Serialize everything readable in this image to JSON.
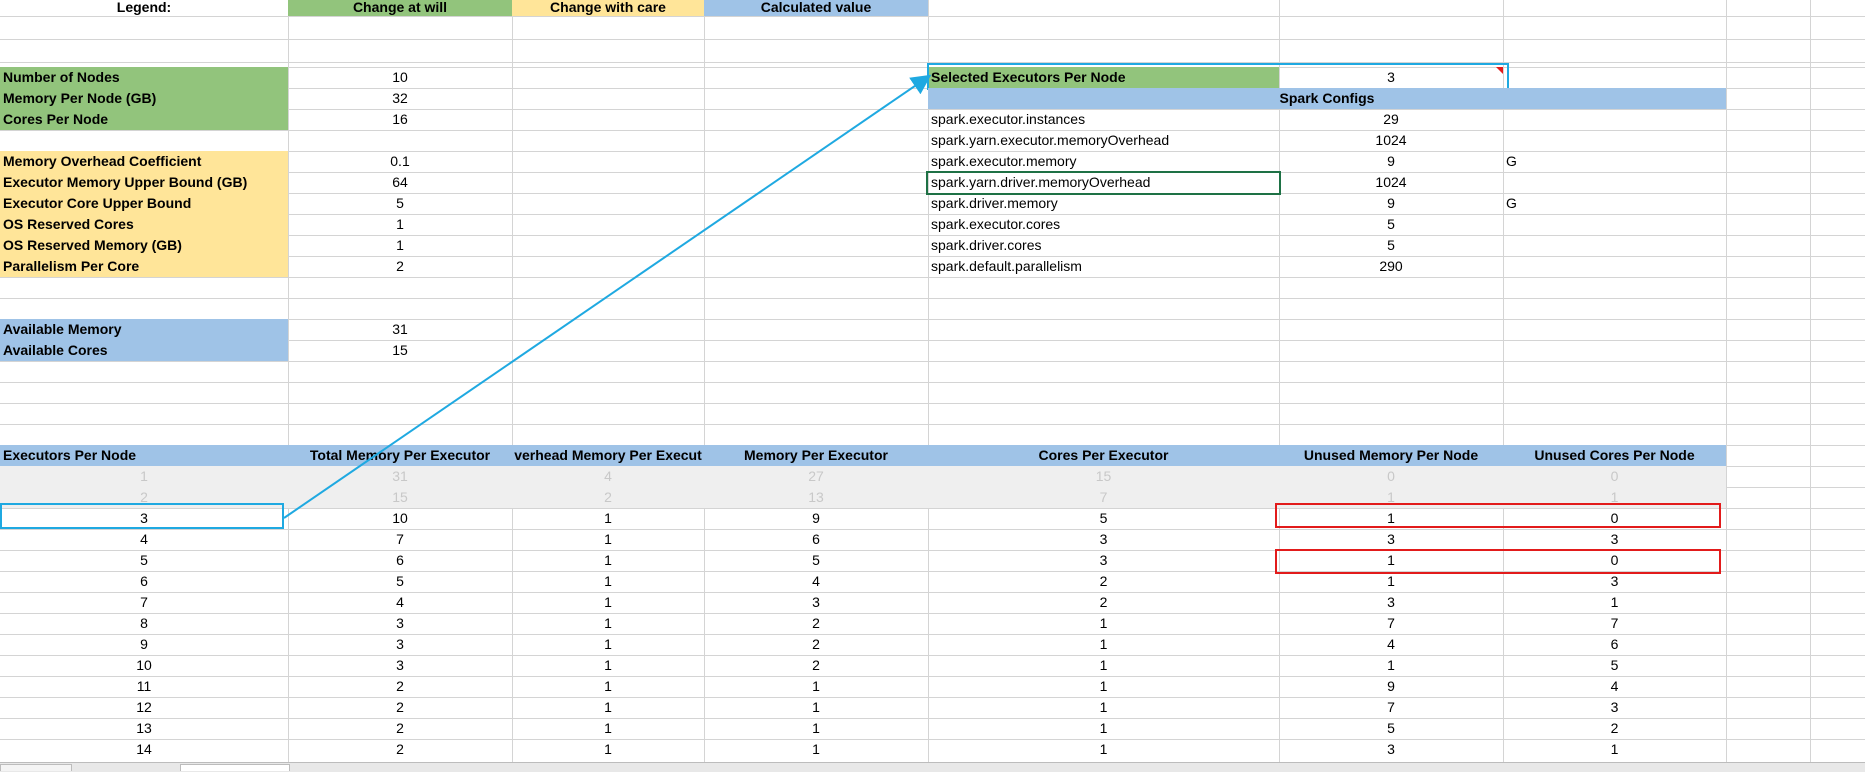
{
  "legend": {
    "label": "Legend:",
    "change_at_will": "Change at will",
    "change_with_care": "Change with care",
    "calculated_value": "Calculated value"
  },
  "inputs": [
    {
      "label": "Number of Nodes",
      "value": "10",
      "kind": "green"
    },
    {
      "label": "Memory Per Node (GB)",
      "value": "32",
      "kind": "green"
    },
    {
      "label": "Cores Per Node",
      "value": "16",
      "kind": "green"
    },
    {
      "label": "Memory Overhead Coefficient",
      "value": "0.1",
      "kind": "yellow"
    },
    {
      "label": "Executor Memory Upper Bound (GB)",
      "value": "64",
      "kind": "yellow"
    },
    {
      "label": "Executor Core Upper Bound",
      "value": "5",
      "kind": "yellow"
    },
    {
      "label": "OS Reserved Cores",
      "value": "1",
      "kind": "yellow"
    },
    {
      "label": "OS Reserved Memory (GB)",
      "value": "1",
      "kind": "yellow"
    },
    {
      "label": "Parallelism Per Core",
      "value": "2",
      "kind": "yellow"
    },
    {
      "label": "Available Memory",
      "value": "31",
      "kind": "blue"
    },
    {
      "label": "Available Cores",
      "value": "15",
      "kind": "blue"
    }
  ],
  "selected": {
    "label": "Selected Executors Per Node",
    "value": "3"
  },
  "spark_configs": {
    "title": "Spark Configs",
    "rows": [
      {
        "key": "spark.executor.instances",
        "value": "29",
        "unit": ""
      },
      {
        "key": "spark.yarn.executor.memoryOverhead",
        "value": "1024",
        "unit": ""
      },
      {
        "key": "spark.executor.memory",
        "value": "9",
        "unit": "G"
      },
      {
        "key": "spark.yarn.driver.memoryOverhead",
        "value": "1024",
        "unit": ""
      },
      {
        "key": "spark.driver.memory",
        "value": "9",
        "unit": "G"
      },
      {
        "key": "spark.executor.cores",
        "value": "5",
        "unit": ""
      },
      {
        "key": "spark.driver.cores",
        "value": "5",
        "unit": ""
      },
      {
        "key": "spark.default.parallelism",
        "value": "290",
        "unit": ""
      }
    ]
  },
  "table": {
    "headers": [
      "Executors Per Node",
      "Total Memory Per Executor",
      "verhead Memory Per Execut",
      "Memory Per Executor",
      "Cores Per Executor",
      "Unused Memory Per Node",
      "Unused Cores Per Node"
    ],
    "rows": [
      [
        "1",
        "31",
        "4",
        "27",
        "15",
        "0",
        "0"
      ],
      [
        "2",
        "15",
        "2",
        "13",
        "7",
        "1",
        "1"
      ],
      [
        "3",
        "10",
        "1",
        "9",
        "5",
        "1",
        "0"
      ],
      [
        "4",
        "7",
        "1",
        "6",
        "3",
        "3",
        "3"
      ],
      [
        "5",
        "6",
        "1",
        "5",
        "3",
        "1",
        "0"
      ],
      [
        "6",
        "5",
        "1",
        "4",
        "2",
        "1",
        "3"
      ],
      [
        "7",
        "4",
        "1",
        "3",
        "2",
        "3",
        "1"
      ],
      [
        "8",
        "3",
        "1",
        "2",
        "1",
        "7",
        "7"
      ],
      [
        "9",
        "3",
        "1",
        "2",
        "1",
        "4",
        "6"
      ],
      [
        "10",
        "3",
        "1",
        "2",
        "1",
        "1",
        "5"
      ],
      [
        "11",
        "2",
        "1",
        "1",
        "1",
        "9",
        "4"
      ],
      [
        "12",
        "2",
        "1",
        "1",
        "1",
        "7",
        "3"
      ],
      [
        "13",
        "2",
        "1",
        "1",
        "1",
        "5",
        "2"
      ],
      [
        "14",
        "2",
        "1",
        "1",
        "1",
        "3",
        "1"
      ]
    ]
  },
  "colors": {
    "accent_arrow": "#1fa9e1",
    "highlight_red": "#e21b1b",
    "green": "#92c47c",
    "yellow": "#ffe599",
    "blue": "#9fc3e7"
  }
}
